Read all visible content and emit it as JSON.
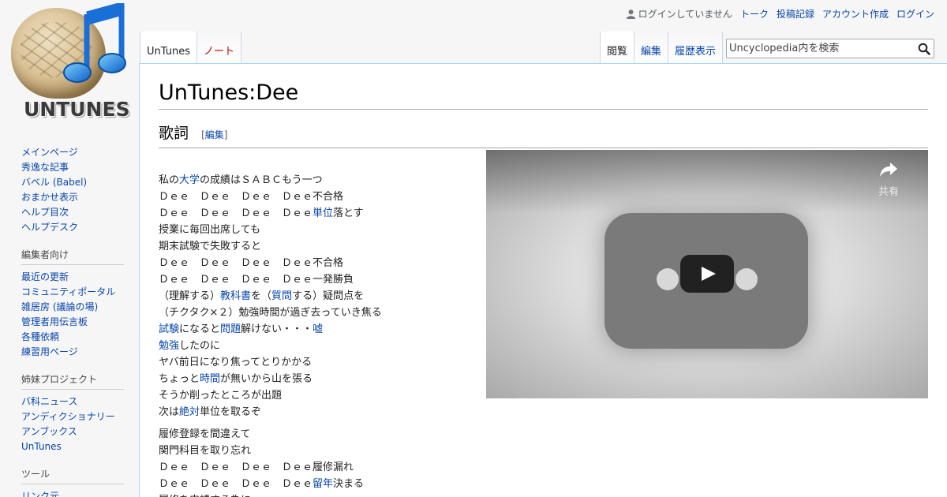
{
  "logo": {
    "wordmark": "UNTUNES"
  },
  "personal": {
    "anon_text": "ログインしていません",
    "links": [
      "トーク",
      "投稿記録",
      "アカウント作成",
      "ログイン"
    ]
  },
  "tabs": {
    "left": [
      {
        "label": "UnTunes",
        "selected": true
      },
      {
        "label": "ノート",
        "selected": false
      }
    ],
    "right": [
      {
        "label": "閲覧",
        "selected": true
      },
      {
        "label": "編集",
        "selected": false
      },
      {
        "label": "履歴表示",
        "selected": false
      }
    ]
  },
  "search": {
    "placeholder": "Uncyclopedia内を検索"
  },
  "sidebar": {
    "navigation": [
      "メインページ",
      "秀逸な記事",
      "バベル (Babel)",
      "おまかせ表示",
      "ヘルプ目次",
      "ヘルプデスク"
    ],
    "editors": {
      "heading": "編集者向け",
      "items": [
        "最近の更新",
        "コミュニティポータル",
        "雑居房 (議論の場)",
        "管理者用伝言板",
        "各種依頼",
        "練習用ページ"
      ]
    },
    "sister": {
      "heading": "姉妹プロジェクト",
      "items": [
        "バ科ニュース",
        "アンディクショナリー",
        "アンブックス",
        "UnTunes"
      ]
    },
    "tools": {
      "heading": "ツール",
      "items": [
        "リンク元"
      ]
    }
  },
  "page": {
    "title": "UnTunes:Dee",
    "section_heading": "歌詞",
    "edit_bracket_open": "[",
    "edit_link": "編集",
    "edit_bracket_close": "]"
  },
  "video": {
    "share_label": "共有"
  },
  "colors": {
    "link": "#0645ad",
    "border_blue": "#a7d7f9",
    "new_link": "#ba0000"
  }
}
